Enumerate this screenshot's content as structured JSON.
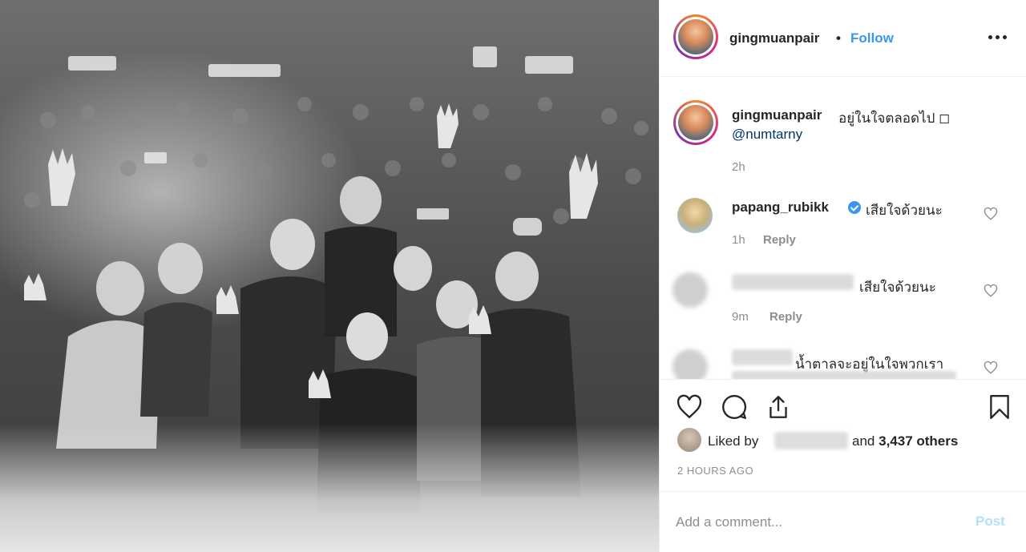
{
  "photo": {
    "alt": "Group photo on stage in black and white"
  },
  "header": {
    "username": "gingmuanpair",
    "separator": "•",
    "follow_label": "Follow",
    "more_icon": "more-horizontal-icon"
  },
  "caption": {
    "username": "gingmuanpair",
    "text": "อยู่ในใจตลอดไป ◻",
    "mention": "@numtarny",
    "time": "2h"
  },
  "comments": [
    {
      "username": "papang_rubikk",
      "verified": true,
      "text": "เสียใจด้วยนะ",
      "time": "1h",
      "reply_label": "Reply"
    },
    {
      "username": "",
      "text": "เสียใจด้วยนะ",
      "time": "9m",
      "reply_label": "Reply"
    },
    {
      "username": "",
      "text": "น้ำตาลจะอยู่ในใจพวกเรา",
      "time": "",
      "reply_label": ""
    }
  ],
  "actions": {
    "like_icon": "heart-icon",
    "comment_icon": "comment-icon",
    "share_icon": "share-icon",
    "save_icon": "bookmark-icon"
  },
  "likes": {
    "prefix": "Liked by",
    "connector": "and",
    "count": "3,437 others"
  },
  "timestamp": "2 HOURS AGO",
  "add_comment": {
    "placeholder": "Add a comment...",
    "post_label": "Post"
  },
  "colors": {
    "link": "#3897f0",
    "mention": "#003569",
    "muted": "#8e8e8e",
    "post_disabled": "#b2dffc"
  }
}
